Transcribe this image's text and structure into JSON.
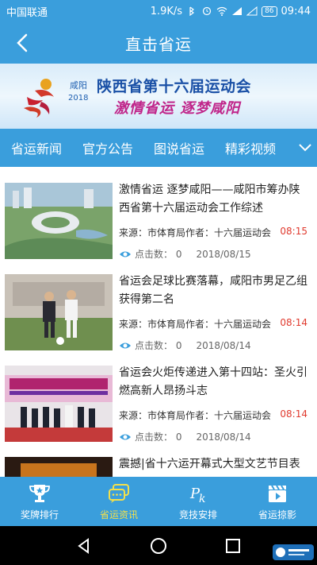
{
  "status": {
    "carrier": "中国联通",
    "speed": "1.9K/s",
    "battery": "86",
    "time": "09:44"
  },
  "header": {
    "title": "直击省运"
  },
  "banner": {
    "city": "咸阳",
    "year": "2018",
    "title": "陕西省第十六届运动会",
    "slogan": "激情省运  逐梦咸阳"
  },
  "tabs": [
    "省运新闻",
    "官方公告",
    "图说省运",
    "精彩视频"
  ],
  "news": [
    {
      "headline": "激情省运 逐梦咸阳——咸阳市筹办陕西省第十六届运动会工作综述",
      "source": "来源：市体育局作者：十六届运动会",
      "time": "08:15",
      "clicks": "点击数：  0",
      "date": "2018/08/15"
    },
    {
      "headline": "省运会足球比赛落幕，咸阳市男足乙组获得第二名",
      "source": "来源：市体育局作者：十六届运动会",
      "time": "08:14",
      "clicks": "点击数：  0",
      "date": "2018/08/14"
    },
    {
      "headline": "省运会火炬传递进入第十四站：圣火引燃高新人昂扬斗志",
      "source": "来源：市体育局作者：十六届运动会",
      "time": "08:14",
      "clicks": "点击数：  0",
      "date": "2018/08/14"
    },
    {
      "headline": "震撼|省十六运开幕式大型文艺节目表",
      "source": "",
      "time": "",
      "clicks": "",
      "date": ""
    }
  ],
  "bottom_nav": [
    {
      "label": "奖牌排行",
      "icon": "trophy-icon"
    },
    {
      "label": "省运资讯",
      "icon": "chat-icon"
    },
    {
      "label": "竞技安排",
      "icon": "pk-icon"
    },
    {
      "label": "省运掠影",
      "icon": "clapperboard-icon"
    }
  ],
  "colors": {
    "primary": "#3a9edc",
    "active": "#f4e04a",
    "time": "#e03a2e"
  }
}
